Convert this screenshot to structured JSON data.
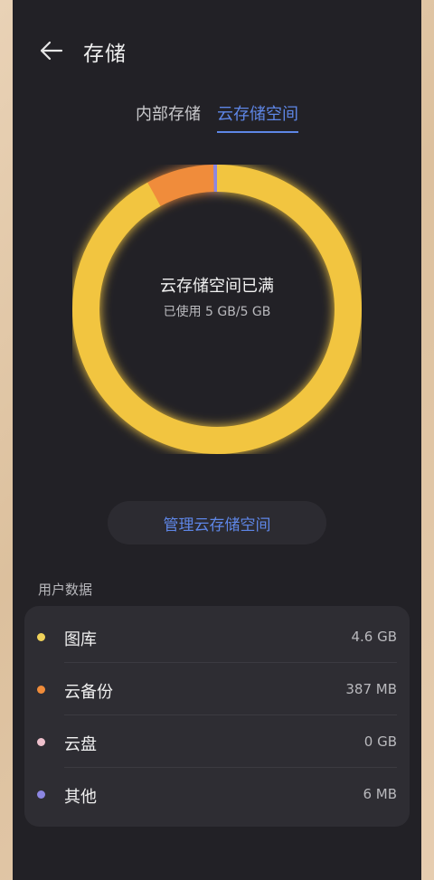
{
  "header": {
    "title": "存储",
    "back_icon": "arrow-left-icon"
  },
  "tabs": [
    {
      "label": "内部存储",
      "active": false
    },
    {
      "label": "云存储空间",
      "active": true
    }
  ],
  "storage": {
    "status_title": "云存储空间已满",
    "usage_text": "已使用 5 GB/5 GB",
    "used_fraction": 1.0,
    "segments": [
      {
        "name": "图库",
        "fraction": 0.92,
        "color": "#f2c53f"
      },
      {
        "name": "云备份",
        "fraction": 0.0756,
        "color": "#f08c3a"
      },
      {
        "name": "云盘",
        "fraction": 0.0,
        "color": "#e8a9bd"
      },
      {
        "name": "其他",
        "fraction": 0.0044,
        "color": "#8c86e2"
      }
    ]
  },
  "manage_button": {
    "label": "管理云存储空间"
  },
  "user_data": {
    "section_label": "用户数据",
    "items": [
      {
        "label": "图库",
        "value": "4.6 GB",
        "color": "#f0d25a"
      },
      {
        "label": "云备份",
        "value": "387 MB",
        "color": "#f08c3a"
      },
      {
        "label": "云盘",
        "value": "0 GB",
        "color": "#eec0cc"
      },
      {
        "label": "其他",
        "value": "6 MB",
        "color": "#8c86e2"
      }
    ]
  },
  "colors": {
    "accent": "#5e86e6",
    "background": "#222126",
    "card": "#2e2d33"
  }
}
